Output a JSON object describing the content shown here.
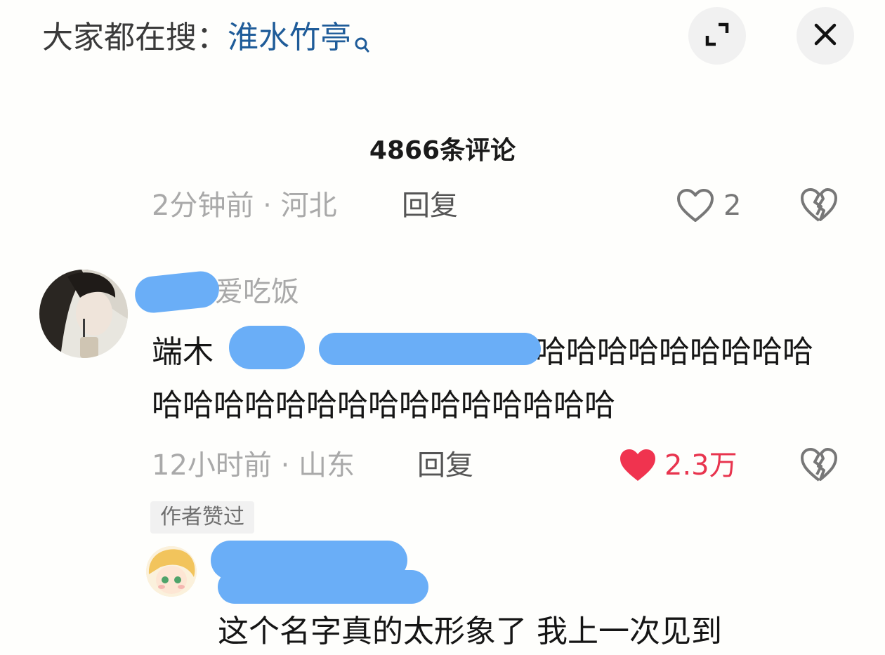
{
  "header": {
    "hot_search_prefix": "大家都在搜：",
    "hot_search_keyword": "淮水竹亭"
  },
  "comment_count": "4866条评论",
  "prev_comment": {
    "meta": "2分钟前 · 河北",
    "reply_label": "回复",
    "likes": "2"
  },
  "comment": {
    "username": "爱吃饭",
    "line1_prefix": "端木",
    "line1_suffix": "哈哈哈哈哈哈哈哈哈",
    "line2": "哈哈哈哈哈哈哈哈哈哈哈哈哈哈哈",
    "meta": "12小时前 · 山东",
    "reply_label": "回复",
    "likes": "2.3万",
    "badge": "作者赞过"
  },
  "reply": {
    "text": "这个名字真的太形象了 我上一次见到"
  },
  "colors": {
    "keyword": "#1f5c99",
    "like_active": "#e8344e",
    "redaction": "#6aaef7"
  }
}
